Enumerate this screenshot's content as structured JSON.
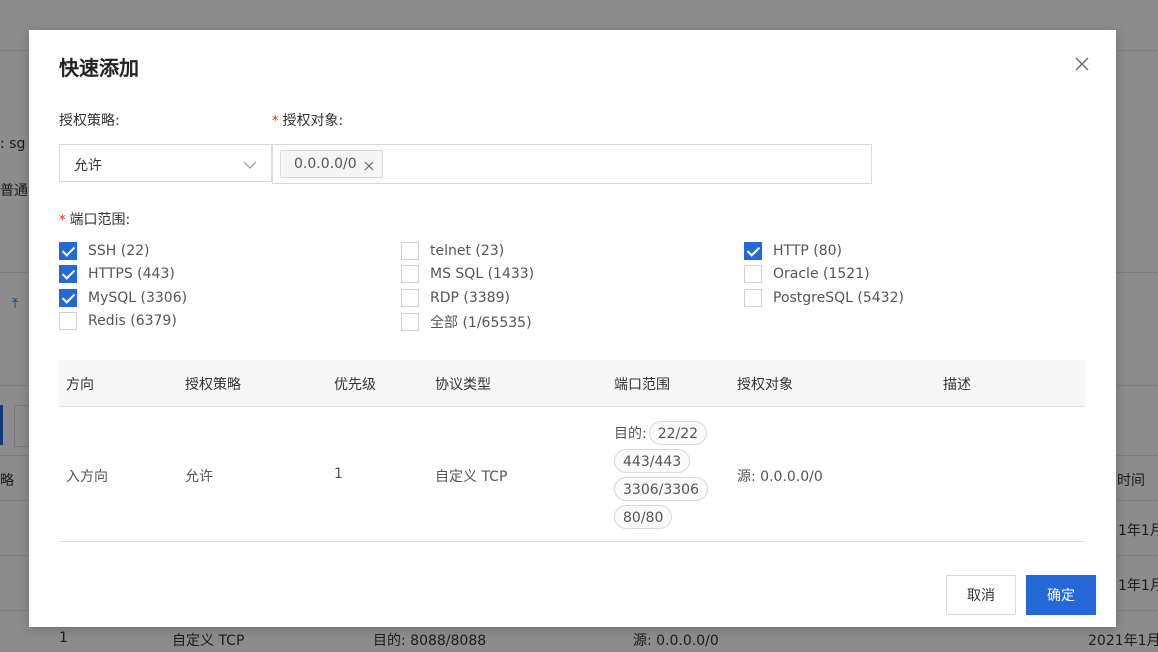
{
  "background": {
    "fragments": [
      ": sg",
      "普通",
      "略",
      "1",
      "自定义 TCP",
      "目的: 8088/8088",
      "源: 0.0.0.0/0",
      "时间",
      "1年1月",
      "1年1月",
      "2021年1月"
    ]
  },
  "modal": {
    "title": "快速添加",
    "policy_label": "授权策略:",
    "target_label": "授权对象:",
    "port_label": "端口范围:",
    "required_mark": "*",
    "policy_value": "允许",
    "target_tag": "0.0.0.0/0",
    "ports": [
      {
        "label": "SSH (22)",
        "checked": true
      },
      {
        "label": "telnet (23)",
        "checked": false
      },
      {
        "label": "HTTP (80)",
        "checked": true
      },
      {
        "label": "HTTPS (443)",
        "checked": true
      },
      {
        "label": "MS SQL (1433)",
        "checked": false
      },
      {
        "label": "Oracle (1521)",
        "checked": false
      },
      {
        "label": "MySQL (3306)",
        "checked": true
      },
      {
        "label": "RDP (3389)",
        "checked": false
      },
      {
        "label": "PostgreSQL (5432)",
        "checked": false
      },
      {
        "label": "Redis (6379)",
        "checked": false
      },
      {
        "label": "全部 (1/65535)",
        "checked": false
      }
    ],
    "table": {
      "headers": [
        "方向",
        "授权策略",
        "优先级",
        "协议类型",
        "端口范围",
        "授权对象",
        "描述"
      ],
      "row": {
        "direction": "入方向",
        "policy": "允许",
        "priority": "1",
        "protocol": "自定义 TCP",
        "port_prefix": "目的:",
        "ports": [
          "22/22",
          "443/443",
          "3306/3306",
          "80/80"
        ],
        "target": "源: 0.0.0.0/0",
        "description": ""
      }
    },
    "cancel_label": "取消",
    "ok_label": "确定"
  },
  "colors": {
    "accent": "#2469d6",
    "required": "#e0201a",
    "overlay": "rgba(0,0,0,0.45)"
  }
}
